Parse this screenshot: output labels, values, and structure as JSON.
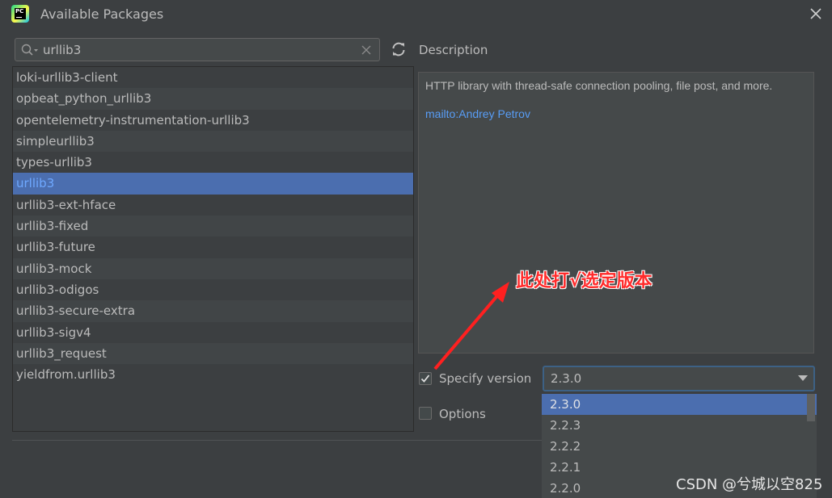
{
  "window": {
    "title": "Available Packages",
    "app_icon": "pycharm-icon"
  },
  "search": {
    "value": "urllib3",
    "icons": [
      "search-icon",
      "clear-icon",
      "refresh-icon"
    ]
  },
  "packages": [
    "loki-urllib3-client",
    "opbeat_python_urllib3",
    "opentelemetry-instrumentation-urllib3",
    "simpleurllib3",
    "types-urllib3",
    "urllib3",
    "urllib3-ext-hface",
    "urllib3-fixed",
    "urllib3-future",
    "urllib3-mock",
    "urllib3-odigos",
    "urllib3-secure-extra",
    "urllib3-sigv4",
    "urllib3_request",
    "yieldfrom.urllib3"
  ],
  "selected_package_index": 5,
  "description": {
    "label": "Description",
    "text": "HTTP library with thread-safe connection pooling, file post, and more.",
    "link": "mailto:Andrey Petrov"
  },
  "specify_version": {
    "label": "Specify version",
    "checked": true,
    "value": "2.3.0"
  },
  "options": {
    "label": "Options",
    "checked": false
  },
  "version_dropdown": {
    "items": [
      "2.3.0",
      "2.2.3",
      "2.2.2",
      "2.2.1",
      "2.2.0"
    ],
    "selected_index": 0
  },
  "annotation": {
    "text": "此处打√选定版本",
    "color": "#ff2b2b"
  },
  "watermark": "CSDN @兮城以空825",
  "colors": {
    "background": "#3c3f41",
    "selection": "#4b6eaf",
    "link": "#589df6"
  }
}
